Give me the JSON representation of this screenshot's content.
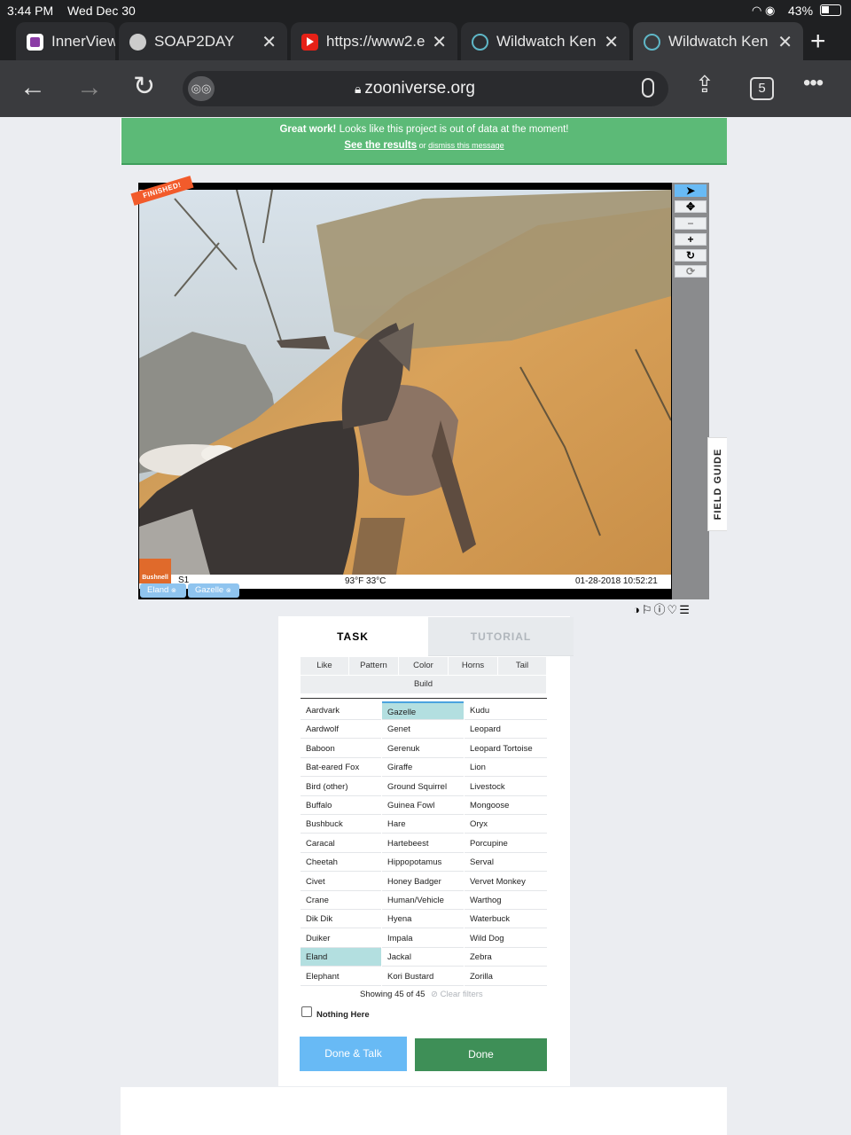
{
  "status_bar": {
    "time": "3:44 PM",
    "date": "Wed Dec 30",
    "battery": "43%"
  },
  "tabs": [
    {
      "label": "InnerView",
      "icon": "innerview-icon",
      "active": false
    },
    {
      "label": "SOAP2DAY",
      "icon": "globe-icon",
      "active": false
    },
    {
      "label": "https://www2.e",
      "icon": "youtube-icon",
      "active": false
    },
    {
      "label": "Wildwatch Keny",
      "icon": "zooniverse-icon",
      "active": false
    },
    {
      "label": "Wildwatch Ken",
      "icon": "zooniverse-icon",
      "active": true
    }
  ],
  "toolbar": {
    "url": "zooniverse.org",
    "tab_count": "5"
  },
  "banner": {
    "bold": "Great work!",
    "message": " Looks like this project is out of data at the moment!",
    "results_link": "See the results",
    "or": " or ",
    "dismiss_link": "dismiss this message"
  },
  "viewer": {
    "finished_label": "FINISHED!",
    "camera_brand": "Bushnell",
    "camera_id": "S1",
    "temperature": "93°F 33°C",
    "timestamp": "01-28-2018 10:52:21",
    "selected_chips": [
      "Eland",
      "Gazelle"
    ],
    "field_guide": "FIELD GUIDE"
  },
  "task": {
    "tab_task": "TASK",
    "tab_tutorial": "TUTORIAL",
    "filters": [
      "Like",
      "Pattern",
      "Color",
      "Horns",
      "Tail",
      "Build"
    ],
    "columns": [
      [
        "Aardvark",
        "Aardwolf",
        "Baboon",
        "Bat-eared Fox",
        "Bird (other)",
        "Buffalo",
        "Bushbuck",
        "Caracal",
        "Cheetah",
        "Civet",
        "Crane",
        "Dik Dik",
        "Duiker",
        "Eland",
        "Elephant"
      ],
      [
        "Gazelle",
        "Genet",
        "Gerenuk",
        "Giraffe",
        "Ground Squirrel",
        "Guinea Fowl",
        "Hare",
        "Hartebeest",
        "Hippopotamus",
        "Honey Badger",
        "Human/Vehicle",
        "Hyena",
        "Impala",
        "Jackal",
        "Kori Bustard"
      ],
      [
        "Kudu",
        "Leopard",
        "Leopard Tortoise",
        "Lion",
        "Livestock",
        "Mongoose",
        "Oryx",
        "Porcupine",
        "Serval",
        "Vervet Monkey",
        "Warthog",
        "Waterbuck",
        "Wild Dog",
        "Zebra",
        "Zorilla"
      ]
    ],
    "selected": [
      "Eland",
      "Gazelle"
    ],
    "showing": "Showing 45 of 45",
    "clear_filters": "Clear filters",
    "nothing_here": "Nothing Here",
    "done_talk": "Done & Talk",
    "done": "Done"
  },
  "colors": {
    "banner": "#5cba77",
    "done": "#3e8f57",
    "done_talk": "#68baf5",
    "finished": "#f25b2b",
    "selected": "#b3dfe0"
  }
}
